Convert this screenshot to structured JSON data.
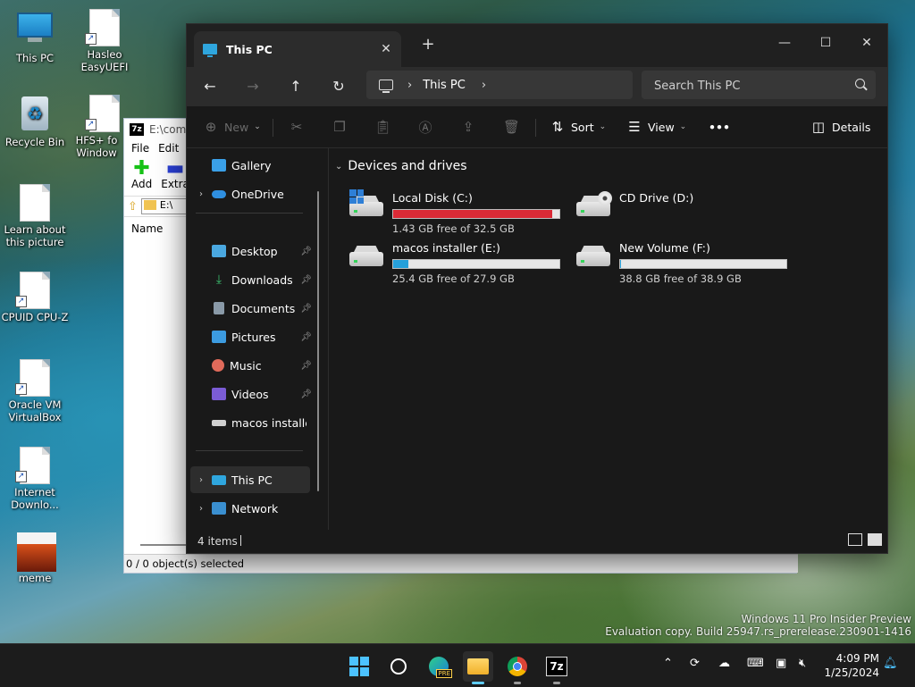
{
  "desktop": {
    "icons": [
      {
        "label": "This PC"
      },
      {
        "label": "Hasleo EasyUEFI"
      },
      {
        "label": "Recycle Bin"
      },
      {
        "label": "HFS+ fo Window"
      },
      {
        "label": "Learn about this picture"
      },
      {
        "label": "CPUID CPU-Z"
      },
      {
        "label": "Oracle VM VirtualBox"
      },
      {
        "label": "Internet Downlo..."
      },
      {
        "label": "meme"
      }
    ]
  },
  "bg_window_7z": {
    "title": "E:\\com...",
    "logo": "7z",
    "menu": [
      "File",
      "Edit"
    ],
    "tools": [
      "Add",
      "Extra"
    ],
    "address": "E:\\",
    "column_name": "Name",
    "status": "0 / 0 object(s) selected"
  },
  "explorer": {
    "tab_title": "This PC",
    "nav": {
      "address_crumb": "This PC",
      "search_placeholder": "Search This PC"
    },
    "commands": {
      "new": "New",
      "sort": "Sort",
      "view": "View",
      "more": "•••",
      "details": "Details"
    },
    "sidebar": [
      {
        "label": "Gallery",
        "icon": "gallery-icon",
        "color": "#3aa0e8"
      },
      {
        "label": "OneDrive",
        "icon": "cloud-icon",
        "color": "#2f8fe0"
      },
      {
        "label": "Desktop",
        "icon": "desktop-icon",
        "color": "#4aa8e0"
      },
      {
        "label": "Downloads",
        "icon": "download-icon",
        "color": "#3bbd6e"
      },
      {
        "label": "Documents",
        "icon": "document-icon",
        "color": "#8a9aa8"
      },
      {
        "label": "Pictures",
        "icon": "pictures-icon",
        "color": "#3c9be0"
      },
      {
        "label": "Music",
        "icon": "music-icon",
        "color": "#e06a5a"
      },
      {
        "label": "Videos",
        "icon": "videos-icon",
        "color": "#7b5cd6"
      },
      {
        "label": "macos installer (",
        "icon": "drive-icon",
        "color": "#d0d0d0"
      },
      {
        "label": "This PC",
        "icon": "this-pc-icon",
        "color": "#2fa6de"
      },
      {
        "label": "Network",
        "icon": "network-icon",
        "color": "#3a8fd0"
      }
    ],
    "section_title": "Devices and drives",
    "drives": [
      {
        "name": "Local Disk (C:)",
        "free": "1.43 GB free of 32.5 GB",
        "used_fraction": 0.956,
        "bar_color": "#da2a36",
        "has_bar": true
      },
      {
        "name": "CD Drive (D:)",
        "free": "",
        "used_fraction": 0,
        "bar_color": "#26a0da",
        "has_bar": false
      },
      {
        "name": "macos installer (E:)",
        "free": "25.4 GB free of 27.9 GB",
        "used_fraction": 0.09,
        "bar_color": "#26a0da",
        "has_bar": true
      },
      {
        "name": "New Volume (F:)",
        "free": "38.8 GB free of 38.9 GB",
        "used_fraction": 0.003,
        "bar_color": "#26a0da",
        "has_bar": true
      }
    ],
    "status": "4 items"
  },
  "watermark": {
    "line1": "Windows 11 Pro Insider Preview",
    "line2": "Evaluation copy. Build 25947.rs_prerelease.230901-1416"
  },
  "taskbar": {
    "time": "4:09 PM",
    "date": "1/25/2024",
    "pre_badge": "PRE",
    "app_7z": "7z"
  }
}
